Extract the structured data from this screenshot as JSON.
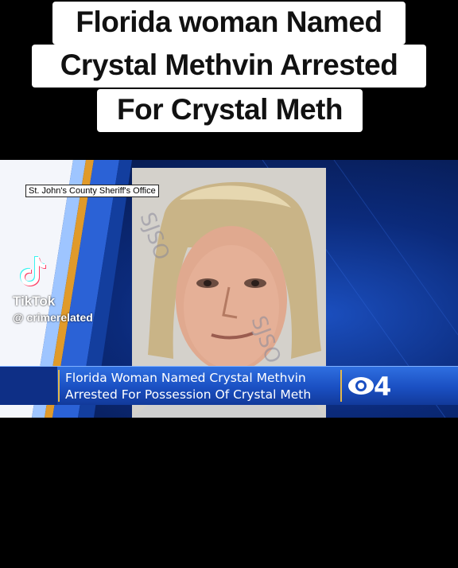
{
  "headline": {
    "line1": "Florida woman Named",
    "line2": "Crystal Methvin Arrested",
    "line3": "For Crystal Meth"
  },
  "video": {
    "source_label": "St. John's County Sheriff's Office",
    "lower_third": {
      "line1": "Florida Woman Named Crystal Methvin",
      "line2": "Arrested For Possession Of Crystal Meth"
    },
    "station_logo": {
      "icon": "cbs-eye-icon",
      "channel": "4"
    },
    "watermark": {
      "app": "TikTok",
      "handle": "@ crimerelated"
    },
    "colors": {
      "bar_blue": "#1a4fc2",
      "accent_gold": "#e4b84a"
    }
  }
}
